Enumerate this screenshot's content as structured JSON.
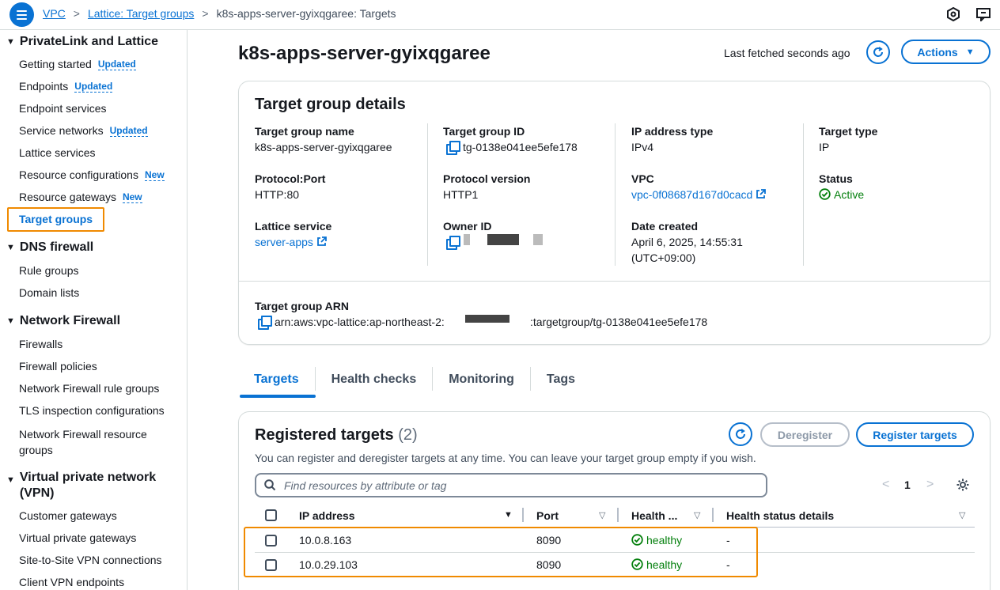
{
  "breadcrumb": {
    "items": [
      "VPC",
      "Lattice: Target groups"
    ],
    "current": "k8s-apps-server-gyixqgaree: Targets"
  },
  "sidebar": {
    "sections": [
      {
        "title": "PrivateLink and Lattice"
      },
      {
        "title": "DNS firewall"
      },
      {
        "title": "Network Firewall"
      },
      {
        "title": "Virtual private network (VPN)"
      }
    ],
    "items": [
      {
        "label": "Getting started",
        "badge": "Updated"
      },
      {
        "label": "Endpoints",
        "badge": "Updated"
      },
      {
        "label": "Endpoint services",
        "badge": ""
      },
      {
        "label": "Service networks",
        "badge": "Updated"
      },
      {
        "label": "Lattice services",
        "badge": ""
      },
      {
        "label": "Resource configurations",
        "badge": "New"
      },
      {
        "label": "Resource gateways",
        "badge": "New"
      },
      {
        "label": "Target groups",
        "badge": ""
      },
      {
        "label": "Rule groups"
      },
      {
        "label": "Domain lists"
      },
      {
        "label": "Firewalls"
      },
      {
        "label": "Firewall policies"
      },
      {
        "label": "Network Firewall rule groups"
      },
      {
        "label": "TLS inspection configurations"
      },
      {
        "label": "Network Firewall resource groups"
      },
      {
        "label": "Customer gateways"
      },
      {
        "label": "Virtual private gateways"
      },
      {
        "label": "Site-to-Site VPN connections"
      },
      {
        "label": "Client VPN endpoints"
      }
    ]
  },
  "header": {
    "title": "k8s-apps-server-gyixqgaree",
    "last_fetched": "Last fetched seconds ago",
    "actions_label": "Actions"
  },
  "details": {
    "title": "Target group details",
    "name_label": "Target group name",
    "name": "k8s-apps-server-gyixqgaree",
    "id_label": "Target group ID",
    "id": "tg-0138e041ee5efe178",
    "ip_type_label": "IP address type",
    "ip_type": "IPv4",
    "target_type_label": "Target type",
    "target_type": "IP",
    "protocol_port_label": "Protocol:Port",
    "protocol_port": "HTTP:80",
    "protocol_version_label": "Protocol version",
    "protocol_version": "HTTP1",
    "vpc_label": "VPC",
    "vpc": "vpc-0f08687d167d0cacd",
    "status_label": "Status",
    "status": "Active",
    "lattice_service_label": "Lattice service",
    "lattice_service": "server-apps",
    "owner_label": "Owner ID",
    "date_label": "Date created",
    "date_line1": "April 6, 2025, 14:55:31",
    "date_line2": "(UTC+09:00)",
    "arn_label": "Target group ARN",
    "arn_prefix": "arn:aws:vpc-lattice:ap-northeast-2:",
    "arn_suffix": ":targetgroup/tg-0138e041ee5efe178"
  },
  "tabs": [
    "Targets",
    "Health checks",
    "Monitoring",
    "Tags"
  ],
  "targets": {
    "title": "Registered targets",
    "count": "(2)",
    "description": "You can register and deregister targets at any time. You can leave your target group empty if you wish.",
    "deregister_label": "Deregister",
    "register_label": "Register targets",
    "search_placeholder": "Find resources by attribute or tag",
    "page": "1",
    "columns": [
      "IP address",
      "Port",
      "Health ...",
      "Health status details"
    ],
    "rows": [
      {
        "ip": "10.0.8.163",
        "port": "8090",
        "health": "healthy",
        "details": "-"
      },
      {
        "ip": "10.0.29.103",
        "port": "8090",
        "health": "healthy",
        "details": "-"
      }
    ]
  },
  "colors": {
    "accent": "#0972d3",
    "success": "#037f0c",
    "highlight": "#f08a00"
  }
}
